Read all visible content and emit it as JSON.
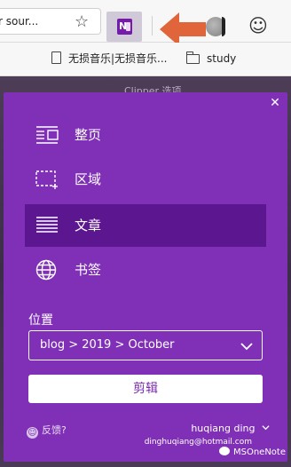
{
  "browser": {
    "address_text": "r sour...",
    "bookmarks": [
      {
        "label": "无损音乐|无损音乐..."
      },
      {
        "label": "study"
      }
    ]
  },
  "page_background_text": "Clipper 选项",
  "clipper": {
    "modes": [
      {
        "label": "整页",
        "icon": "full-page-icon",
        "selected": false
      },
      {
        "label": "区域",
        "icon": "region-icon",
        "selected": false
      },
      {
        "label": "文章",
        "icon": "article-icon",
        "selected": true
      },
      {
        "label": "书签",
        "icon": "bookmark-globe-icon",
        "selected": false
      }
    ],
    "location_label": "位置",
    "location_value": "blog > 2019 > October",
    "clip_button": "剪辑",
    "feedback": "反馈?",
    "user_name": "huqiang ding",
    "user_email": "dinghuqiang@hotmail.com"
  },
  "watermark": "MSOneNote",
  "colors": {
    "panel": "#8030b6",
    "selected_mode": "#5b1690",
    "arrow": "#e0653a"
  }
}
